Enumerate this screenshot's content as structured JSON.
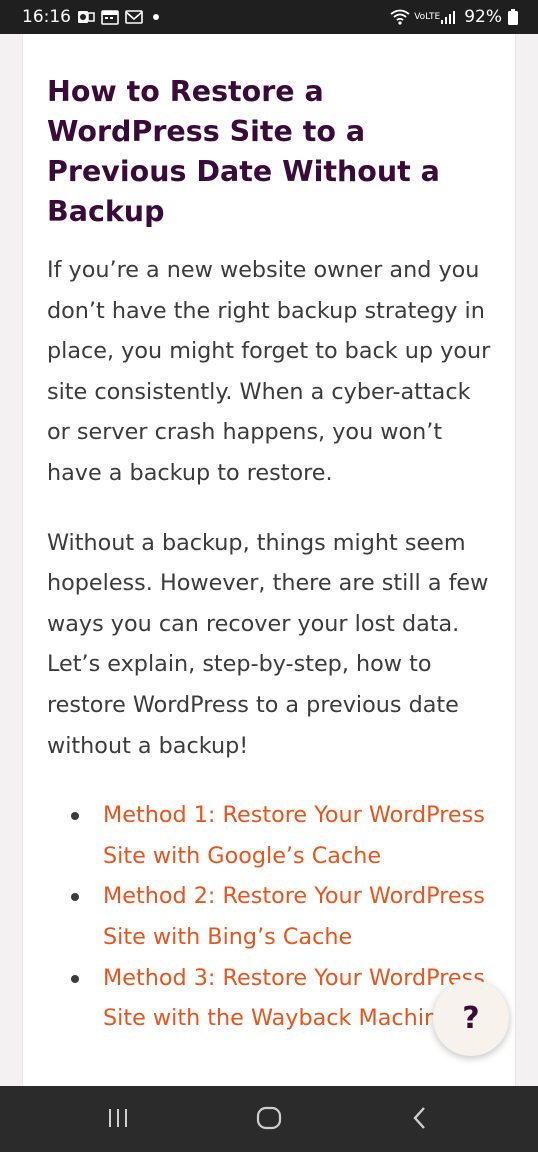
{
  "status_bar": {
    "time": "16:16",
    "battery": "92%",
    "network": "VoLTE"
  },
  "article": {
    "title": "How to Restore a WordPress Site to a Previous Date Without a Backup",
    "paragraphs": [
      "If you’re a new website owner and you don’t have the right backup strategy in place, you might forget to back up your site consistently. When a cyber-attack or server crash happens, you won’t have a backup to restore.",
      "Without a backup, things might seem hopeless. However, there are still a few ways you can recover your lost data. Let’s explain, step-by-step, how to restore WordPress to a previous date without a backup!"
    ],
    "methods": [
      "Method 1: Restore Your WordPress Site with Google’s Cache",
      "Method 2: Restore Your WordPress Site with Bing’s Cache",
      "Method 3: Restore Your WordPress Site with the Wayback Machine"
    ]
  },
  "help_button": {
    "label": "?"
  },
  "colors": {
    "title": "#3a0a3a",
    "body_text": "#3b3b3b",
    "link": "#e8541c"
  },
  "icons": [
    "outlook-icon",
    "calendar-icon",
    "gmail-icon",
    "wifi-icon",
    "signal-icon",
    "battery-icon",
    "recents-icon",
    "home-icon",
    "back-icon"
  ]
}
